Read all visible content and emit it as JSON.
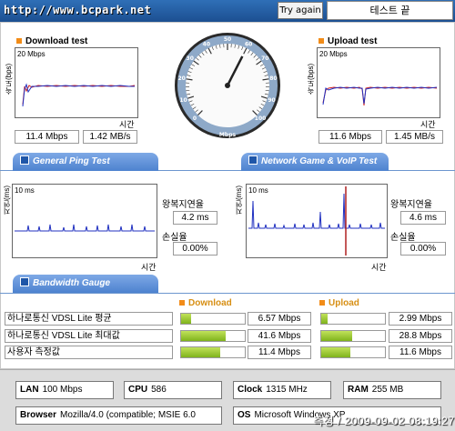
{
  "header": {
    "site_url": "http://www.bcpark.net",
    "try_again_label": "Try again",
    "status": "테스트 끝"
  },
  "download_chart": {
    "title": "Download test",
    "scale": "20 Mbps",
    "ylabel": "속도(bps)",
    "xlabel": "시간",
    "mbps": "11.4 Mbps",
    "mbs": "1.42 MB/s"
  },
  "upload_chart": {
    "title": "Upload test",
    "scale": "20 Mbps",
    "ylabel": "속도(bps)",
    "xlabel": "시간",
    "mbps": "11.6 Mbps",
    "mbs": "1.45 MB/s"
  },
  "gauge": {
    "ticks": [
      "0",
      "10",
      "20",
      "30",
      "40",
      "50",
      "60",
      "70",
      "80",
      "90",
      "100"
    ],
    "unit": "Mbps",
    "needle_value": 60
  },
  "tabs": {
    "ping": "General Ping Test",
    "game": "Network Game & VoIP Test",
    "bandwidth": "Bandwidth Gauge"
  },
  "ping_chart": {
    "scale": "10 ms",
    "ylabel": "지연(ms)",
    "xlabel": "시간",
    "rtt_label": "왕복지연율",
    "rtt": "4.2 ms",
    "loss_label": "손실율",
    "loss": "0.00%"
  },
  "game_chart": {
    "scale": "10 ms",
    "ylabel": "지연(ms)",
    "xlabel": "시간",
    "rtt_label": "왕복지연율",
    "rtt": "4.6 ms",
    "loss_label": "손실율",
    "loss": "0.00%"
  },
  "bandwidth": {
    "download_header": "Download",
    "upload_header": "Upload",
    "rows": [
      {
        "label": "하나로통신 VDSL Lite 평균",
        "download": "6.57 Mbps",
        "download_fill": 0.16,
        "upload": "2.99 Mbps",
        "upload_fill": 0.1
      },
      {
        "label": "하나로통신 VDSL Lite 최대값",
        "download": "41.6 Mbps",
        "download_fill": 0.7,
        "upload": "28.8 Mbps",
        "upload_fill": 0.48
      },
      {
        "label": "사용자 측정값",
        "download": "11.4 Mbps",
        "download_fill": 0.62,
        "upload": "11.6 Mbps",
        "upload_fill": 0.45
      }
    ]
  },
  "footer": {
    "lan_label": "LAN",
    "lan_value": "100 Mbps",
    "cpu_label": "CPU",
    "cpu_value": "586",
    "clock_label": "Clock",
    "clock_value": "1315 MHz",
    "ram_label": "RAM",
    "ram_value": "255 MB",
    "browser_label": "Browser",
    "browser_value": "Mozilla/4.0 (compatible; MSIE 6.0",
    "os_label": "OS",
    "os_value": "Microsoft Windows XP",
    "timestamp": "측정 / 2009-09-02 08:19:27"
  }
}
